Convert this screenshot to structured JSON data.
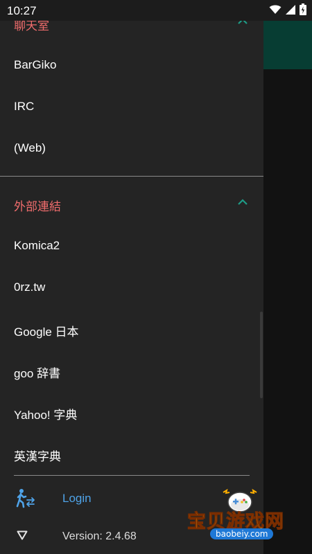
{
  "status_bar": {
    "time": "10:27"
  },
  "drawer": {
    "sections": [
      {
        "title": "聊天室",
        "items": [
          {
            "label": "BarGiko"
          },
          {
            "label": "IRC"
          },
          {
            "label": "(Web)"
          }
        ]
      },
      {
        "title": "外部連結",
        "items": [
          {
            "label": "Komica2"
          },
          {
            "label": "0rz.tw"
          },
          {
            "label": "Google 日本"
          },
          {
            "label": "goo 辞書"
          },
          {
            "label": "Yahoo! 字典"
          },
          {
            "label": "英漢字典"
          }
        ]
      }
    ],
    "footer": {
      "login_label": "Login",
      "version_label": "Version: 2.4.68"
    }
  },
  "watermark": {
    "title": "宝贝游戏网",
    "url": "baobeiy.com"
  },
  "colors": {
    "accent_red": "#ef6c6c",
    "accent_teal": "#1e9c86",
    "link_blue": "#4fa3e8",
    "drawer_bg": "#242424",
    "appbar_teal": "#073d33"
  },
  "icons": [
    "wifi-icon",
    "signal-icon",
    "battery-icon",
    "chevron-up-icon",
    "walking-person-icon",
    "triangle-down-icon"
  ]
}
